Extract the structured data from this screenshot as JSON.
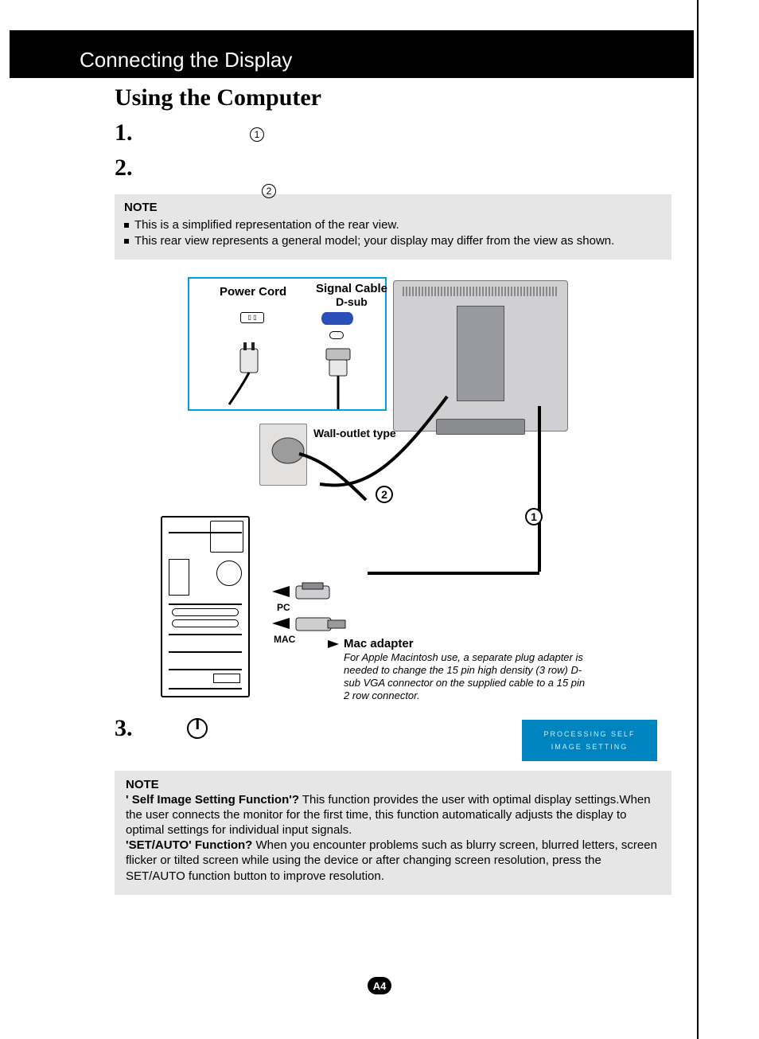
{
  "header": {
    "title": "Connecting the Display"
  },
  "subtitle": "Using the Computer",
  "steps": {
    "one": "1.",
    "two": "2.",
    "three": "3."
  },
  "note_top": {
    "title": "NOTE",
    "bullets": [
      "This is a simplified representation of the rear view.",
      "This rear view represents a general model; your display may differ from the view as shown."
    ]
  },
  "diagram": {
    "power_cord_label": "Power Cord",
    "signal_cable_label": "Signal Cable",
    "signal_cable_sub": "D-sub",
    "wall_outlet_label": "Wall-outlet type",
    "pc_label": "PC",
    "mac_label": "MAC",
    "mac_adapter_title": "Mac adapter",
    "mac_adapter_text": "For Apple Macintosh use, a separate plug adapter is needed to change the 15 pin high density (3 row) D-sub VGA connector on the supplied cable to a 15 pin 2 row connector.",
    "circ1": "1",
    "circ2": "2"
  },
  "blue_box": {
    "line1": "PROCESSING SELF",
    "line2": "IMAGE SETTING"
  },
  "note_bottom": {
    "title": "NOTE",
    "q1_label": "' Self Image Setting Function'?",
    "q1_text": " This function provides the user with optimal display settings.When the user connects the monitor for the first time, this function automatically adjusts the display to optimal settings for individual input signals.",
    "q2_label": "'SET/AUTO' Function?",
    "q2_text": " When you encounter problems such as blurry screen, blurred letters, screen flicker or tilted screen while using the device or after changing screen resolution, press the SET/AUTO function button to improve resolution."
  },
  "page_number": "A4"
}
